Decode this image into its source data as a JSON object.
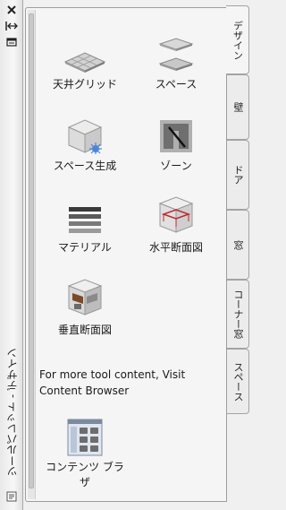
{
  "palette": {
    "title": "ツールパレット - デザイン"
  },
  "tools": [
    {
      "label": "天井グリッド",
      "icon": "ceiling-grid-icon"
    },
    {
      "label": "スペース",
      "icon": "space-icon"
    },
    {
      "label": "スペース生成",
      "icon": "space-generate-icon"
    },
    {
      "label": "ゾーン",
      "icon": "zone-icon"
    },
    {
      "label": "マテリアル",
      "icon": "material-icon"
    },
    {
      "label": "水平断面図",
      "icon": "horizontal-section-icon"
    },
    {
      "label": "垂直断面図",
      "icon": "vertical-section-icon"
    }
  ],
  "note": {
    "text": "For more tool content, Visit Content Browser"
  },
  "content_browser": {
    "label": "コンテンツ ブラザ",
    "icon": "content-browser-icon"
  },
  "tabs": [
    {
      "label": "デザイン",
      "active": true
    },
    {
      "label": "壁",
      "active": false
    },
    {
      "label": "ドア",
      "active": false
    },
    {
      "label": "窓",
      "active": false
    },
    {
      "label": "コーナー窓",
      "active": false
    },
    {
      "label": "スペース",
      "active": false
    }
  ]
}
